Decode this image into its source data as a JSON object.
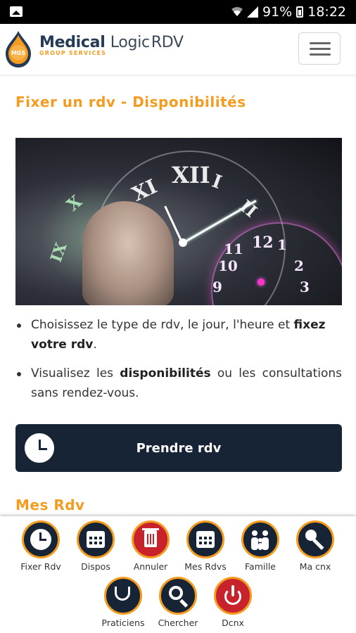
{
  "status_bar": {
    "battery": "91%",
    "time": "18:22"
  },
  "brand": {
    "name_bold": "Medical",
    "name_light": "Logic",
    "name_suffix": "RDV",
    "tagline": "GROUP SERVICES",
    "badge": "MGS"
  },
  "page_title": "Fixer un rdv - Disponibilités",
  "hero_numerals": [
    "XII",
    "I",
    "XI",
    "X",
    "IX",
    "II",
    "12",
    "1",
    "11",
    "10",
    "9",
    "2",
    "3"
  ],
  "bullets": [
    {
      "text_before": "Choisissez le type de rdv, le jour, l'heure et ",
      "bold": "fixez votre rdv",
      "text_after": "."
    },
    {
      "text_before": "Visualisez les ",
      "bold": "disponibilités",
      "text_after": " ou les consultations sans rendez-vous."
    }
  ],
  "cta": {
    "label": "Prendre rdv"
  },
  "section_title": "Mes Rdv",
  "dock": [
    {
      "label": "Fixer Rdv",
      "icon": "clock-icon"
    },
    {
      "label": "Dispos",
      "icon": "calendar-icon"
    },
    {
      "label": "Annuler",
      "icon": "trash-icon"
    },
    {
      "label": "Mes Rdvs",
      "icon": "calendar-icon"
    },
    {
      "label": "Famille",
      "icon": "family-icon"
    },
    {
      "label": "Ma cnx",
      "icon": "key-icon"
    },
    {
      "label": "Praticiens",
      "icon": "stethoscope-icon"
    },
    {
      "label": "Chercher",
      "icon": "search-icon"
    },
    {
      "label": "Dcnx",
      "icon": "power-icon"
    }
  ],
  "colors": {
    "accent": "#f39c1f",
    "navy": "#172436",
    "danger": "#c8222d"
  }
}
